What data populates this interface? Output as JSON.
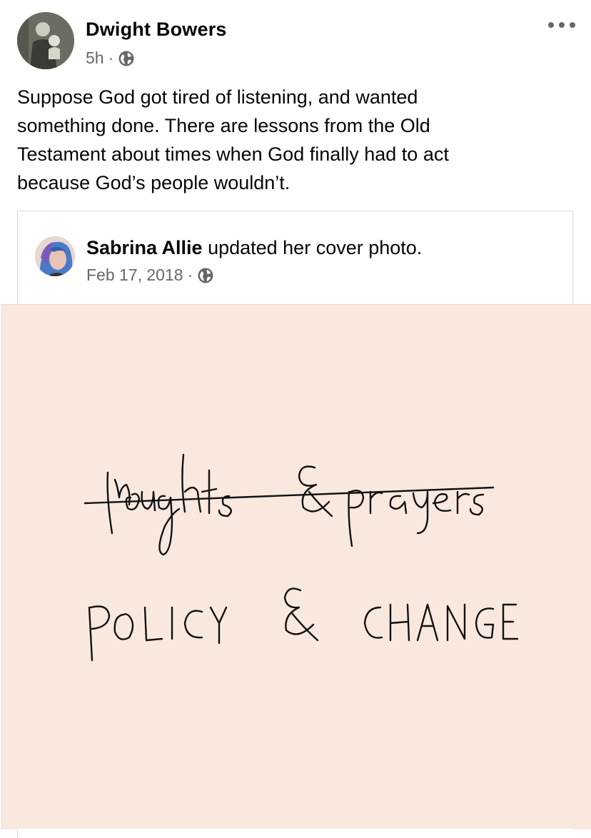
{
  "post": {
    "author": "Dwight Bowers",
    "time": "5h",
    "separator": "·",
    "privacy_icon": "globe-icon",
    "more_icon": "more-horizontal-icon",
    "text_lines": [
      "Suppose God got tired of listening, and wanted",
      "something done.  There are lessons from the Old",
      "Testament about times when God finally had to act",
      "because God’s people wouldn’t."
    ]
  },
  "shared": {
    "name": "Sabrina Allie",
    "action": " updated her cover photo.",
    "date": "Feb 17, 2018",
    "separator": "·",
    "privacy_icon": "globe-icon",
    "cover": {
      "background": "#f9e8de",
      "crossed_out_text": "thoughts & prayers",
      "text": "POLICY & CHANGE"
    }
  },
  "colors": {
    "text": "#050505",
    "secondary": "#65676b",
    "border": "#dadde1"
  }
}
